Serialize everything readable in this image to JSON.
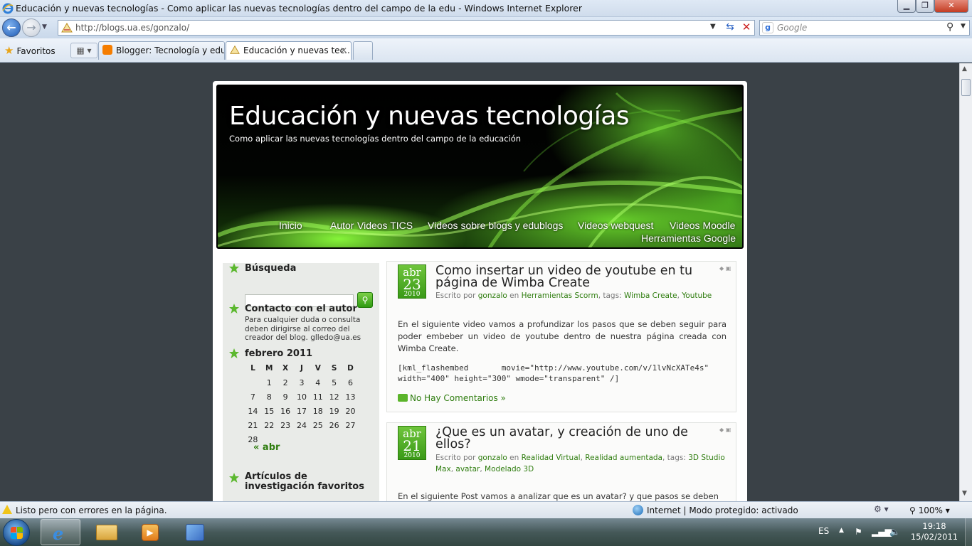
{
  "window": {
    "title": "Educación y nuevas tecnologías - Como aplicar las nuevas tecnologías dentro del campo de la edu - Windows Internet Explorer",
    "minimize_icon": "minimize-icon",
    "maximize_icon": "maximize-icon",
    "close_icon": "close-icon"
  },
  "navbar": {
    "url": "http://blogs.ua.es/gonzalo/",
    "search_placeholder": "Google"
  },
  "favorites_bar": {
    "favorites_label": "Favoritos",
    "tabs": [
      {
        "label": "Blogger: Tecnología y edu...",
        "active": false
      },
      {
        "label": "Educación y nuevas tec...",
        "active": true
      }
    ]
  },
  "blog": {
    "title": "Educación y nuevas tecnologías",
    "subtitle": "Como aplicar las nuevas tecnologías dentro del campo de la educación",
    "nav": [
      "Inicio",
      "Autor",
      "Videos TICS",
      "Videos sobre blogs y edublogs",
      "Videos webquest",
      "Videos Moodle",
      "Herramientas Google"
    ]
  },
  "sidebar": {
    "search_title": "Búsqueda",
    "contact_title": "Contacto con el autor",
    "contact_text": "Para cualquier duda o consulta deben dirigirse al correo del creador del blog. glledo@ua.es",
    "calendar_title": "febrero 2011",
    "calendar_days": [
      "L",
      "M",
      "X",
      "J",
      "V",
      "S",
      "D"
    ],
    "calendar_weeks": [
      [
        "",
        "1",
        "2",
        "3",
        "4",
        "5",
        "6"
      ],
      [
        "7",
        "8",
        "9",
        "10",
        "11",
        "12",
        "13"
      ],
      [
        "14",
        "15",
        "16",
        "17",
        "18",
        "19",
        "20"
      ],
      [
        "21",
        "22",
        "23",
        "24",
        "25",
        "26",
        "27"
      ],
      [
        "28",
        "",
        "",
        "",
        "",
        "",
        ""
      ]
    ],
    "calendar_prev": "« abr",
    "articles_title": "Artículos de investigación favoritos"
  },
  "posts": [
    {
      "month": "abr",
      "day": "23",
      "year": "2010",
      "title": "Como insertar un video de youtube en tu página de Wimba Create",
      "meta_prefix": "Escrito por",
      "author": "gonzalo",
      "meta_in": "en",
      "category": "Herramientas Scorm",
      "meta_tags": ", tags:",
      "tags": [
        "Wimba Create",
        "Youtube"
      ],
      "body": "En el siguiente video vamos a profundizar los pasos que se deben seguir para poder embeber un video de youtube dentro de nuestra página creada con Wimba Create.",
      "code": "[kml_flashembed       movie=\"http://www.youtube.com/v/1lvNcXATe4s\"\nwidth=\"400\" height=\"300\" wmode=\"transparent\" /]",
      "comments": "No Hay Comentarios »"
    },
    {
      "month": "abr",
      "day": "21",
      "year": "2010",
      "title": "¿Que es un avatar, y creación de uno de ellos?",
      "meta_prefix": "Escrito por",
      "author": "gonzalo",
      "meta_in": "en",
      "categories": [
        "Realidad Virtual",
        "Realidad aumentada"
      ],
      "meta_tags": ", tags:",
      "tags": [
        "3D Studio Max",
        "avatar",
        "Modelado 3D"
      ],
      "body": "En el siguiente Post vamos a analizar que es un avatar? y que pasos se deben"
    }
  ],
  "statusbar": {
    "text": "Listo pero con errores en la página.",
    "zone": "Internet | Modo protegido: activado",
    "zoom": "100%"
  },
  "taskbar": {
    "language": "ES",
    "time": "19:18",
    "date": "15/02/2011"
  }
}
